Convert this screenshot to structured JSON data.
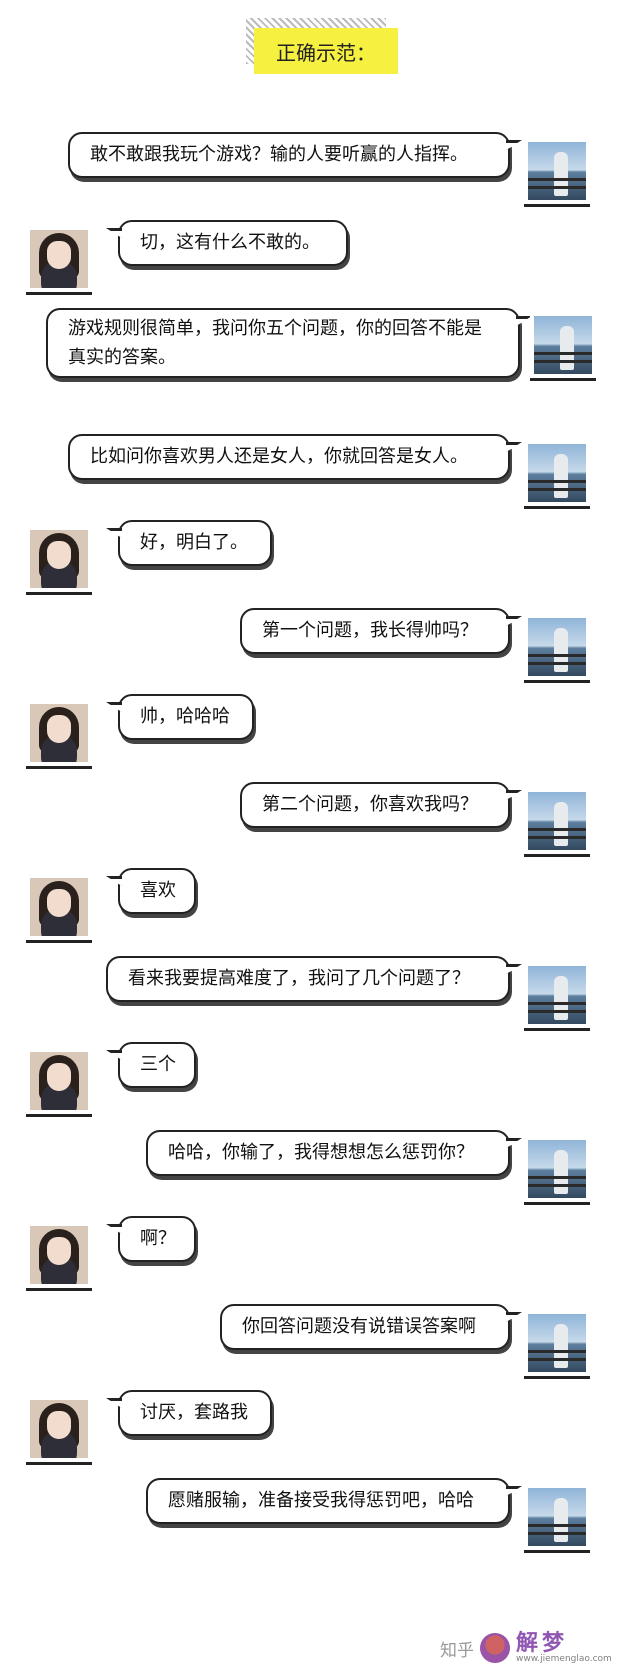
{
  "title": "正确示范：",
  "messages": [
    {
      "side": "right",
      "text": "敢不敢跟我玩个游戏？输的人要听赢的人指挥。"
    },
    {
      "side": "left",
      "text": "切，这有什么不敢的。"
    },
    {
      "side": "right",
      "text": "游戏规则很简单，我问你五个问题，你的回答不能是真实的答案。"
    },
    {
      "side": "right",
      "text": "比如问你喜欢男人还是女人，你就回答是女人。"
    },
    {
      "side": "left",
      "text": "好，明白了。"
    },
    {
      "side": "right",
      "text": "第一个问题，我长得帅吗？"
    },
    {
      "side": "left",
      "text": "帅，哈哈哈"
    },
    {
      "side": "right",
      "text": "第二个问题，你喜欢我吗？"
    },
    {
      "side": "left",
      "text": "喜欢"
    },
    {
      "side": "right",
      "text": "看来我要提高难度了，我问了几个问题了？"
    },
    {
      "side": "left",
      "text": "三个"
    },
    {
      "side": "right",
      "text": "哈哈，你输了，我得想想怎么惩罚你？"
    },
    {
      "side": "left",
      "text": "啊？"
    },
    {
      "side": "right",
      "text": "你回答问题没有说错误答案啊"
    },
    {
      "side": "left",
      "text": "讨厌，套路我"
    },
    {
      "side": "right",
      "text": "愿赌服输，准备接受我得惩罚吧，哈哈"
    }
  ],
  "watermark": {
    "zhihu": "知乎",
    "brand": "解梦",
    "url": "www.jiemenglao.com"
  },
  "colors": {
    "title_bg": "#f6f041",
    "bubble_border": "#222222"
  }
}
